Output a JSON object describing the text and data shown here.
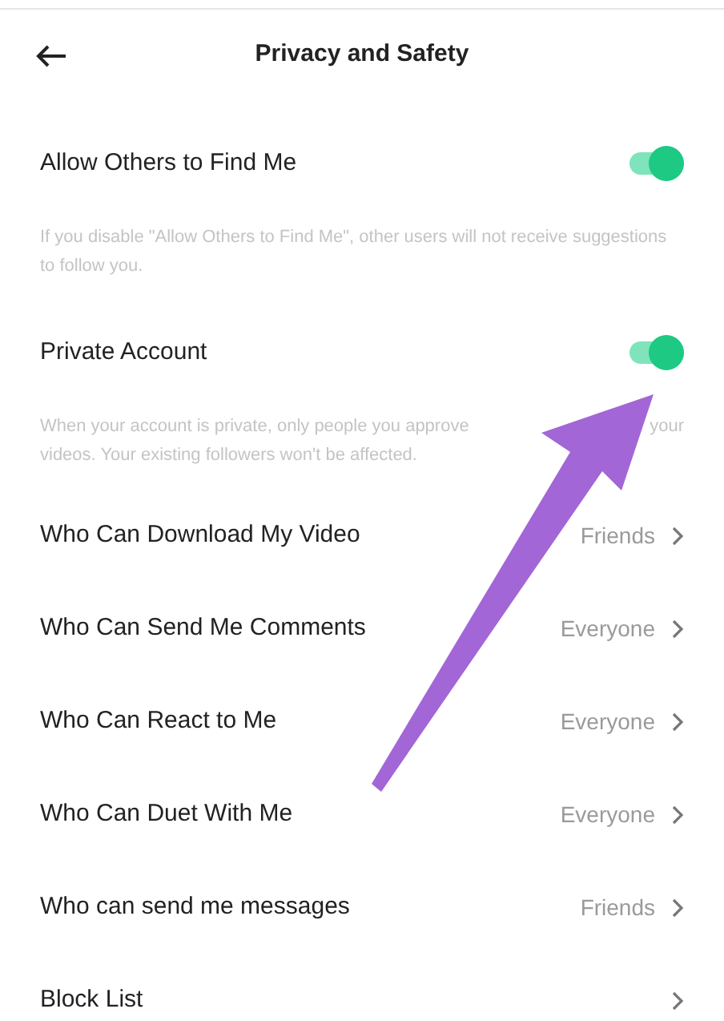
{
  "header": {
    "title": "Privacy and Safety"
  },
  "toggles": [
    {
      "label": "Allow Others to Find Me",
      "on": true,
      "description": [
        "If you disable \"Allow Others to Find Me\", other users will not receive suggestions to follow you."
      ]
    },
    {
      "label": "Private Account",
      "on": true,
      "description": [
        "When your account is private, only people you approve",
        "your",
        "videos. Your existing followers won't be affected."
      ]
    }
  ],
  "settings": [
    {
      "label": "Who Can Download My Video",
      "value": "Friends"
    },
    {
      "label": "Who Can Send Me Comments",
      "value": "Everyone"
    },
    {
      "label": "Who Can React to Me",
      "value": "Everyone"
    },
    {
      "label": "Who Can Duet With Me",
      "value": "Everyone"
    },
    {
      "label": "Who can send me messages",
      "value": "Friends"
    },
    {
      "label": "Block List"
    }
  ]
}
